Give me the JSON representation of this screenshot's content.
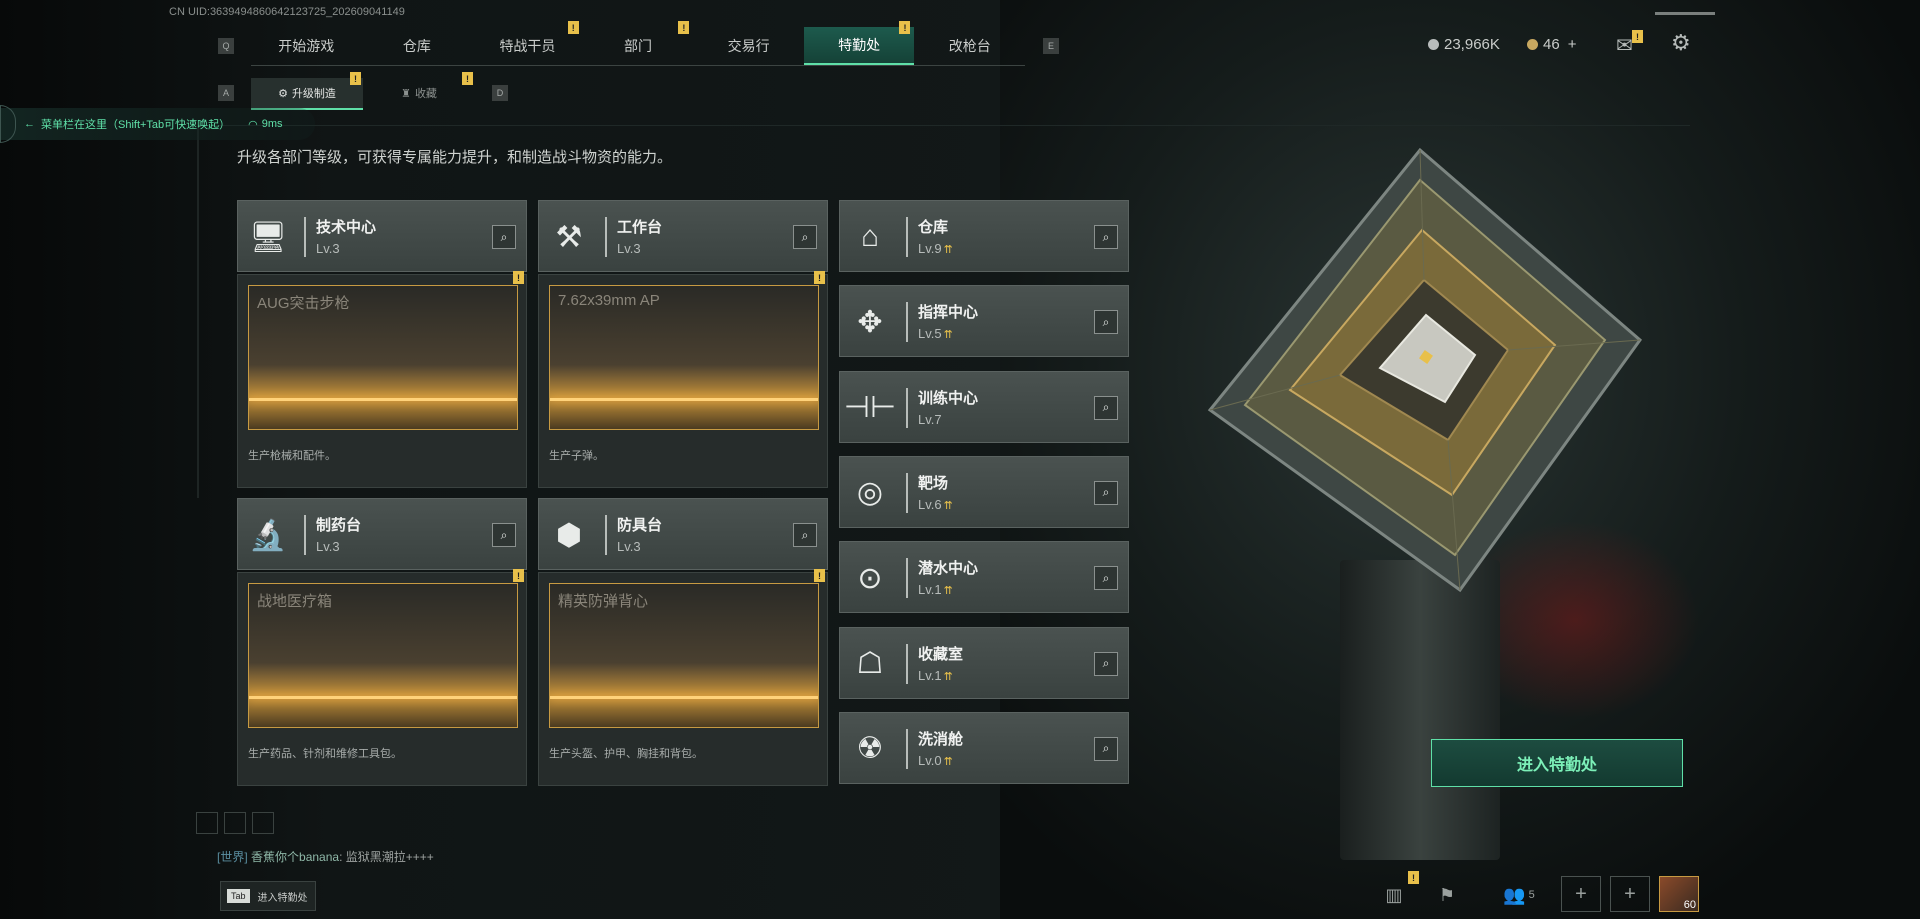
{
  "uid_label": "CN UID:3639494860642123725_202609041149",
  "nav": {
    "left_key": "Q",
    "right_key": "E",
    "tabs": [
      {
        "label": "开始游戏",
        "badge": ""
      },
      {
        "label": "仓库",
        "badge": ""
      },
      {
        "label": "特战干员",
        "badge": "!"
      },
      {
        "label": "部门",
        "badge": "!"
      },
      {
        "label": "交易行",
        "badge": ""
      },
      {
        "label": "特勤处",
        "badge": "!",
        "active": true
      },
      {
        "label": "改枪台",
        "badge": ""
      }
    ]
  },
  "subnav": {
    "left_key": "A",
    "right_key": "D",
    "tabs": [
      {
        "label": "升级制造",
        "active": true,
        "badge": "!"
      },
      {
        "label": "收藏",
        "active": false,
        "badge": "!"
      }
    ]
  },
  "hint": {
    "text": "菜单栏在这里（Shift+Tab可快速唤起）",
    "ping": "9ms"
  },
  "description": "升级各部门等级，可获得专属能力提升，和制造战斗物资的能力。",
  "resources": {
    "currency": "23,966K",
    "tokens": "46",
    "plus": "+",
    "mail_badge": "!"
  },
  "workbenches": [
    {
      "name": "技术中心",
      "level": "Lv.3",
      "icon": "monitor-icon",
      "product": "AUG突击步枪",
      "desc": "生产枪械和配件。",
      "badge": "!"
    },
    {
      "name": "工作台",
      "level": "Lv.3",
      "icon": "tools-icon",
      "product": "7.62x39mm AP",
      "desc": "生产子弹。",
      "badge": "!"
    },
    {
      "name": "制药台",
      "level": "Lv.3",
      "icon": "microscope-icon",
      "product": "战地医疗箱",
      "desc": "生产药品、针剂和维修工具包。",
      "badge": "!"
    },
    {
      "name": "防具台",
      "level": "Lv.3",
      "icon": "cubes-icon",
      "product": "精英防弹背心",
      "desc": "生产头盔、护甲、胸挂和背包。",
      "badge": "!"
    }
  ],
  "facilities": [
    {
      "name": "仓库",
      "level": "Lv.9",
      "upgradable": true,
      "icon": "warehouse-icon"
    },
    {
      "name": "指挥中心",
      "level": "Lv.5",
      "upgradable": true,
      "icon": "command-icon"
    },
    {
      "name": "训练中心",
      "level": "Lv.7",
      "upgradable": false,
      "icon": "dumbbell-icon"
    },
    {
      "name": "靶场",
      "level": "Lv.6",
      "upgradable": true,
      "icon": "target-icon"
    },
    {
      "name": "潜水中心",
      "level": "Lv.1",
      "upgradable": true,
      "icon": "diving-mask-icon"
    },
    {
      "name": "收藏室",
      "level": "Lv.1",
      "upgradable": true,
      "icon": "display-case-icon"
    },
    {
      "name": "洗消舱",
      "level": "Lv.0",
      "upgradable": true,
      "icon": "decon-icon"
    }
  ],
  "enter_button": "进入特勤处",
  "chat": {
    "channel": "[世界]",
    "user": "香蕉你个banana",
    "message": ": 监狱黑潮拉++++"
  },
  "tab_hint": {
    "key": "Tab",
    "label": "进入特勤处"
  },
  "bottom_bar": {
    "friends_count": "5",
    "level_badge": "60",
    "stats_badge": "!"
  },
  "colors": {
    "accent": "#5fe0a8",
    "badge": "#e8c04a",
    "product_glow": "#c5913a"
  }
}
